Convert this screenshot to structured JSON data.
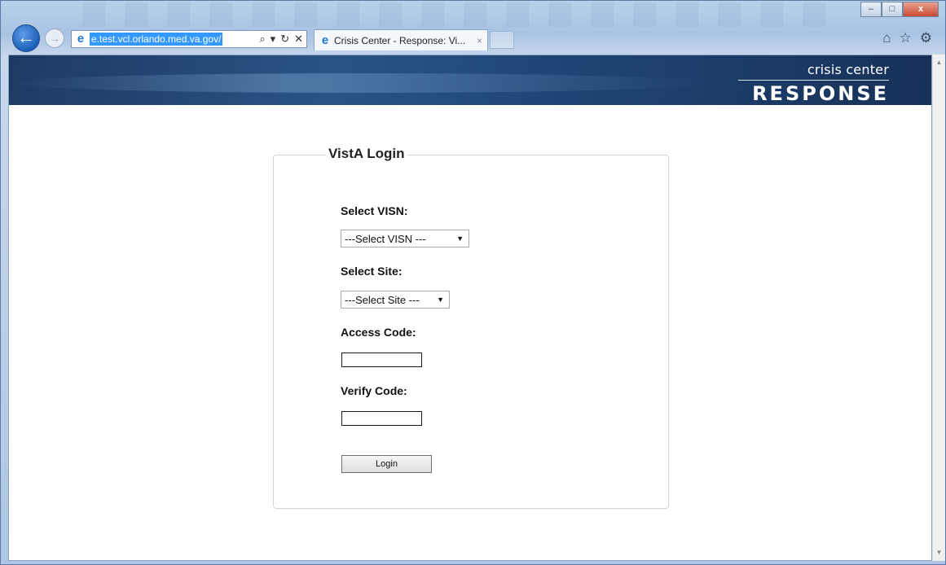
{
  "browser": {
    "url": "e.test.vcl.orlando.med.va.gov/",
    "tab_title": "Crisis Center - Response: Vi...",
    "tab_close": "×",
    "window_buttons": {
      "minimize": "–",
      "maximize": "□",
      "close": "x"
    }
  },
  "banner": {
    "brand_top": "crisis center",
    "brand_main": "RESPONSE"
  },
  "login": {
    "legend": "VistA Login",
    "visn_label": "Select VISN:",
    "visn_selected": "---Select VISN ---",
    "site_label": "Select Site:",
    "site_selected": "---Select Site ---",
    "access_label": "Access Code:",
    "access_value": "",
    "verify_label": "Verify Code:",
    "verify_value": "",
    "login_button": "Login"
  }
}
